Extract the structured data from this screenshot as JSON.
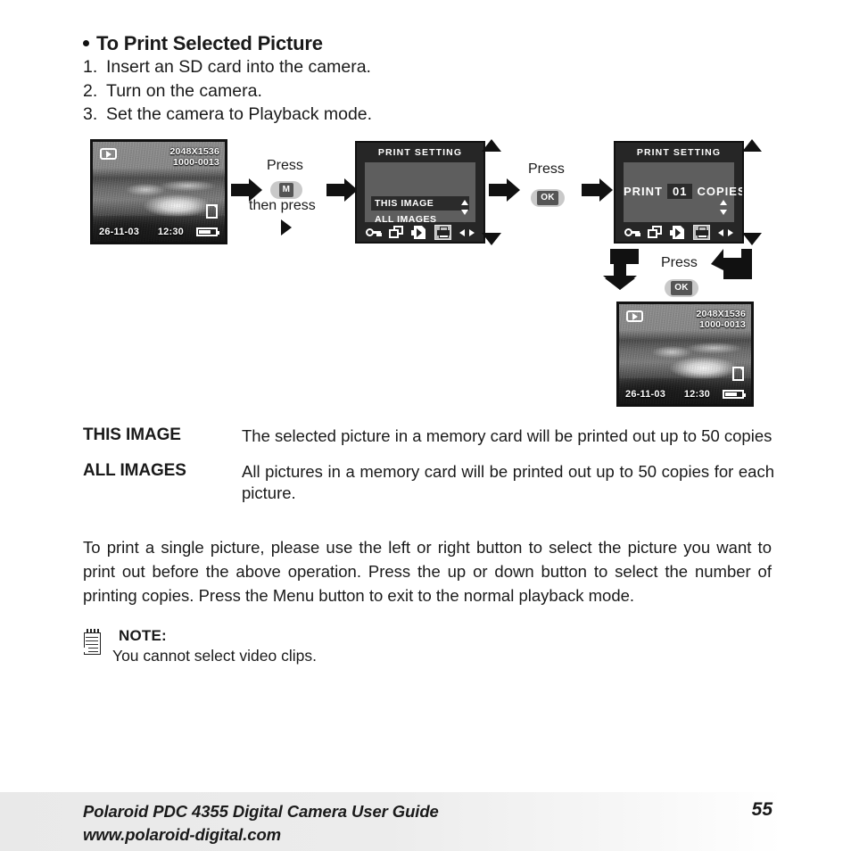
{
  "section": {
    "heading": "To Print Selected Picture",
    "steps": [
      {
        "num": "1.",
        "text": "Insert an SD card into the camera."
      },
      {
        "num": "2.",
        "text": "Turn on the camera."
      },
      {
        "num": "3.",
        "text": "Set the camera to Playback mode."
      }
    ]
  },
  "flow": {
    "screen1": {
      "resolution": "2048X1536",
      "file_number": "1000-0013",
      "date": "26-11-03",
      "time": "12:30",
      "playback_icon": "playback-icon",
      "sd_icon": "sd-card-icon",
      "battery_icon": "battery-icon"
    },
    "press1": {
      "label_top": "Press",
      "button": "M",
      "label_bottom": "then press",
      "direction_icon": "right-triangle-icon"
    },
    "screen2": {
      "title": "PRINT SETTING",
      "options": [
        {
          "label": "THIS IMAGE",
          "selected": true
        },
        {
          "label": "ALL IMAGES",
          "selected": false
        }
      ],
      "icons": [
        "key-icon",
        "copy-icon",
        "transfer-icon",
        "printer-icon",
        "left-right-icon"
      ],
      "active_icon": "printer-icon",
      "scroll_icon": "up-down-icon"
    },
    "press2": {
      "label": "Press",
      "button": "OK"
    },
    "screen3": {
      "title": "PRINT SETTING",
      "print_word": "PRINT",
      "copies_value": "01",
      "copies_word": "COPIES",
      "icons": [
        "key-icon",
        "copy-icon",
        "transfer-icon",
        "printer-icon",
        "left-right-icon"
      ],
      "active_icon": "printer-icon",
      "scroll_icon": "up-down-icon"
    },
    "press3": {
      "label": "Press",
      "button": "OK"
    },
    "screen4": {
      "resolution": "2048X1536",
      "file_number": "1000-0013",
      "date": "26-11-03",
      "time": "12:30",
      "playback_icon": "playback-icon",
      "sd_icon": "sd-card-icon",
      "battery_icon": "battery-icon"
    }
  },
  "definitions": [
    {
      "term": "THIS IMAGE",
      "description": "The selected picture in a memory card will be printed out up to 50 copies"
    },
    {
      "term": "ALL IMAGES",
      "description": "All pictures in a memory card will be printed out up to 50 copies for each picture."
    }
  ],
  "paragraph": "To print a single picture, please use the left or right button to select the picture you want to print out before the above operation. Press the up or down button to select the number of printing copies. Press the Menu button to exit to the normal playback mode.",
  "note": {
    "icon": "notepad-icon",
    "title": "NOTE:",
    "text": "You cannot select video clips."
  },
  "footer": {
    "guide_title": "Polaroid PDC 4355 Digital Camera User Guide",
    "website": "www.polaroid-digital.com",
    "page_number": "55"
  },
  "colors": {
    "ink": "#1a1a1a",
    "lcd_bezel": "#111111",
    "menu_bg": "#262626",
    "menu_body": "#5e5e5e",
    "selection": "#2b2b2b",
    "button_pill": "#c9c9c9",
    "footer_band": "#e9e9e9"
  }
}
